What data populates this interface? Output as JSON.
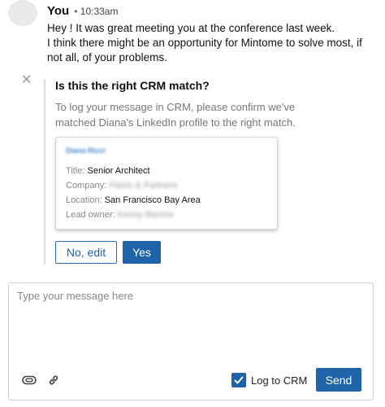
{
  "message": {
    "sender": "You",
    "time": "10:33am",
    "lines": [
      "Hey ! It was great meeting you at the conference last week.",
      "I think there might be an opportunity for Mintome to solve most, if not all, of your problems."
    ]
  },
  "crm": {
    "close_icon": "close-icon",
    "title": "Is this the right CRM match?",
    "description": "To log your message in CRM, please confirm we've matched Diana's LinkedIn profile to the right match.",
    "profile": {
      "name": "Diana Ricci",
      "title_label": "Title:",
      "title_value": "Senior Architect",
      "company_label": "Company:",
      "company_value": "Flavio & Partners",
      "location_label": "Location:",
      "location_value": "San Francisco Bay Area",
      "owner_label": "Lead owner:",
      "owner_value": "Kenny Barone"
    },
    "no_button": "No, edit",
    "yes_button": "Yes"
  },
  "composer": {
    "placeholder": "Type your message here",
    "value": "",
    "attach_icon": "paperclip-icon",
    "link_icon": "link-icon",
    "log_label": "Log to CRM",
    "log_checked": true,
    "send_button": "Send"
  },
  "colors": {
    "accent": "#1f64a8",
    "muted_text": "#777777",
    "border": "#cfcfcf"
  }
}
